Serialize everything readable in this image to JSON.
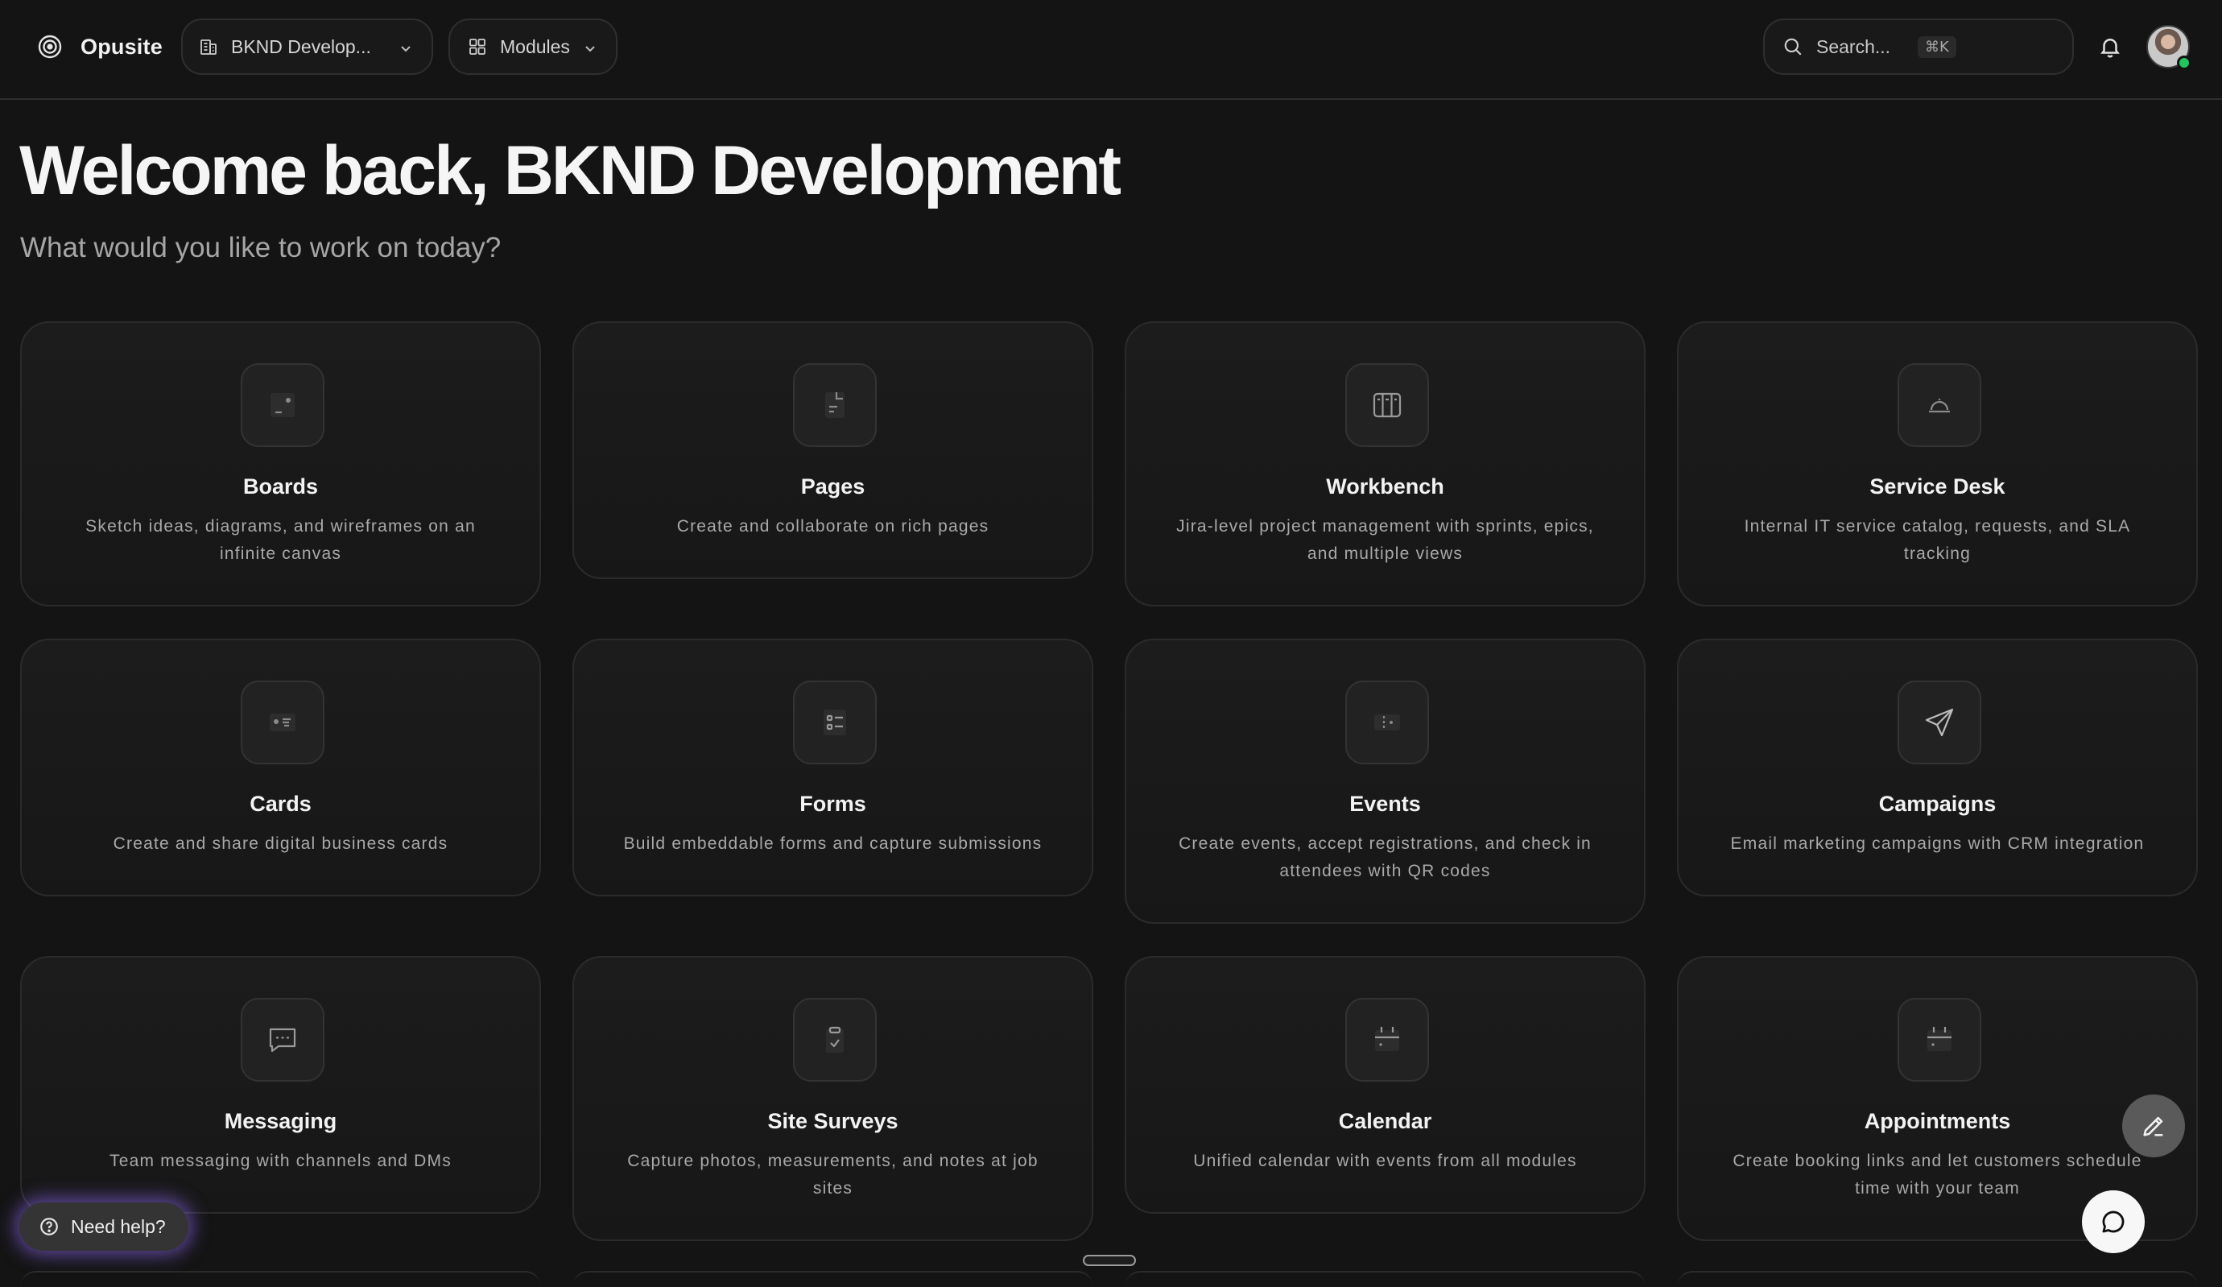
{
  "brand": {
    "name": "Opusite"
  },
  "header": {
    "workspace_label": "BKND Develop...",
    "modules_label": "Modules",
    "search_placeholder": "Search...",
    "search_shortcut": "⌘K"
  },
  "welcome": {
    "title": "Welcome back, BKND Development",
    "subtitle": "What would you like to work on today?"
  },
  "modules": [
    {
      "title": "Boards",
      "icon": "boards-icon",
      "description": "Sketch ideas, diagrams, and wireframes on an infinite canvas"
    },
    {
      "title": "Pages",
      "icon": "pages-icon",
      "description": "Create and collaborate on rich pages"
    },
    {
      "title": "Workbench",
      "icon": "workbench-icon",
      "description": "Jira-level project management with sprints, epics, and multiple views"
    },
    {
      "title": "Service Desk",
      "icon": "service-desk-icon",
      "description": "Internal IT service catalog, requests, and SLA tracking"
    },
    {
      "title": "Cards",
      "icon": "cards-icon",
      "description": "Create and share digital business cards"
    },
    {
      "title": "Forms",
      "icon": "forms-icon",
      "description": "Build embeddable forms and capture submissions"
    },
    {
      "title": "Events",
      "icon": "events-icon",
      "description": "Create events, accept registrations, and check in attendees with QR codes"
    },
    {
      "title": "Campaigns",
      "icon": "campaigns-icon",
      "description": "Email marketing campaigns with CRM integration"
    },
    {
      "title": "Messaging",
      "icon": "messaging-icon",
      "description": "Team messaging with channels and DMs"
    },
    {
      "title": "Site Surveys",
      "icon": "site-surveys-icon",
      "description": "Capture photos, measurements, and notes at job sites"
    },
    {
      "title": "Calendar",
      "icon": "calendar-icon",
      "description": "Unified calendar with events from all modules"
    },
    {
      "title": "Appointments",
      "icon": "appointments-icon",
      "description": "Create booking links and let customers schedule time with your team"
    }
  ],
  "help": {
    "label": "Need help?"
  },
  "colors": {
    "background": "#141414",
    "card": "#1a1a1a",
    "border": "#2b2b2b",
    "help_glow": "#966eff",
    "status_online": "#22c55e"
  }
}
